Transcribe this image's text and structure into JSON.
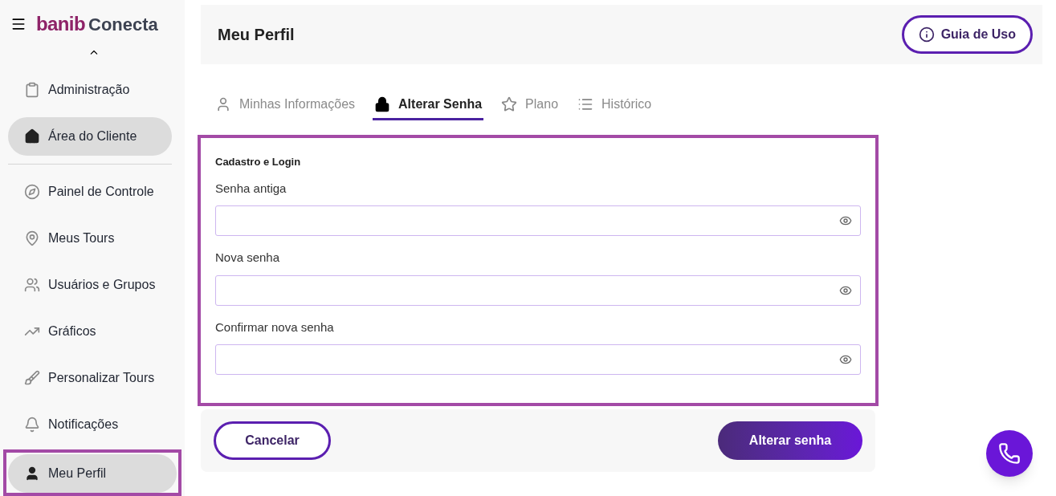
{
  "logo": {
    "mark": "banib",
    "name": "Conecta"
  },
  "sidebar": {
    "expanded": true,
    "items": [
      {
        "label": "Administração",
        "selected": false,
        "highlighted": false
      },
      {
        "label": "Área do Cliente",
        "selected": true,
        "highlighted": false
      },
      {
        "label": "Painel de Controle",
        "selected": false,
        "highlighted": false
      },
      {
        "label": "Meus Tours",
        "selected": false,
        "highlighted": false
      },
      {
        "label": "Usuários e Grupos",
        "selected": false,
        "highlighted": false
      },
      {
        "label": "Gráficos",
        "selected": false,
        "highlighted": false
      },
      {
        "label": "Personalizar Tours",
        "selected": false,
        "highlighted": false
      },
      {
        "label": "Notificações",
        "selected": false,
        "highlighted": false
      },
      {
        "label": "Meu Perfil",
        "selected": true,
        "highlighted": true
      }
    ]
  },
  "header": {
    "title": "Meu Perfil",
    "guide_button": "Guia de Uso"
  },
  "tabs": [
    {
      "label": "Minhas Informações",
      "selected": false
    },
    {
      "label": "Alterar Senha",
      "selected": true
    },
    {
      "label": "Plano",
      "selected": false
    },
    {
      "label": "Histórico",
      "selected": false
    }
  ],
  "form": {
    "highlighted": true,
    "section_title": "Cadastro e Login",
    "fields": [
      {
        "label": "Senha antiga"
      },
      {
        "label": "Nova senha"
      },
      {
        "label": "Confirmar nova senha"
      }
    ]
  },
  "actions": {
    "cancel": "Cancelar",
    "submit": "Alterar senha"
  }
}
